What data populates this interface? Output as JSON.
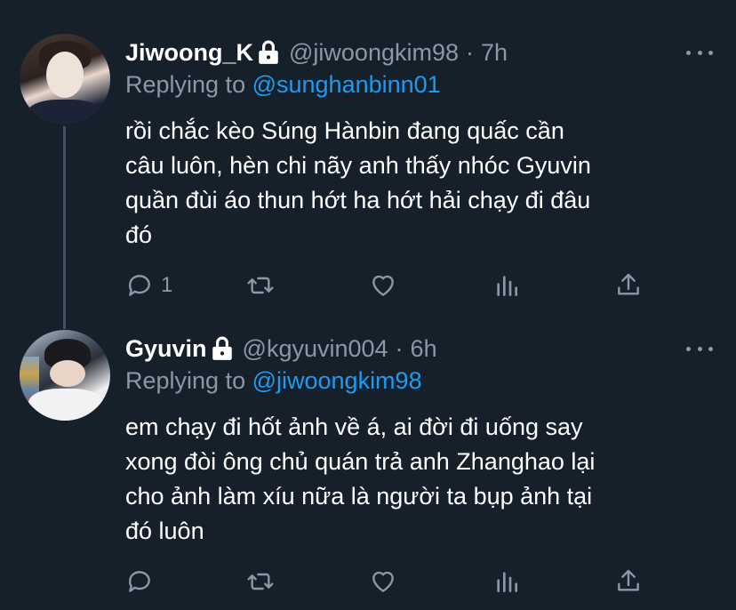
{
  "colors": {
    "background": "#15202b",
    "text": "#ffffff",
    "muted": "#8b98a5",
    "accent": "#1d9bf0",
    "thread_line": "#3d5466"
  },
  "tweets": [
    {
      "name": "Jiwoong_K",
      "locked": true,
      "handle": "@jiwoongkim98",
      "dot": "·",
      "time": "7h",
      "replying_prefix": "Replying to ",
      "replying_to": "@sunghanbinn01",
      "text": "rồi chắc kèo Súng Hànbin đang quấc cần\ncâu luôn, hèn chi nãy anh thấy nhóc Gyuvin\nquần đùi áo thun hớt ha hớt hải chạy đi đâu\nđó",
      "reply_count": "1",
      "retweet_count": "",
      "like_count": "",
      "icons": [
        "reply-icon",
        "retweet-icon",
        "like-icon",
        "analytics-icon",
        "share-icon"
      ]
    },
    {
      "name": "Gyuvin",
      "locked": true,
      "handle": "@kgyuvin004",
      "dot": "·",
      "time": "6h",
      "replying_prefix": "Replying to ",
      "replying_to": "@jiwoongkim98",
      "text": "em chạy đi hốt ảnh về á, ai đời đi uống say\nxong đòi ông chủ quán trả anh Zhanghao lại\ncho ảnh làm xíu nữa là người ta bụp ảnh tại\nđó luôn",
      "reply_count": "",
      "retweet_count": "",
      "like_count": "",
      "icons": [
        "reply-icon",
        "retweet-icon",
        "like-icon",
        "analytics-icon",
        "share-icon"
      ]
    }
  ]
}
